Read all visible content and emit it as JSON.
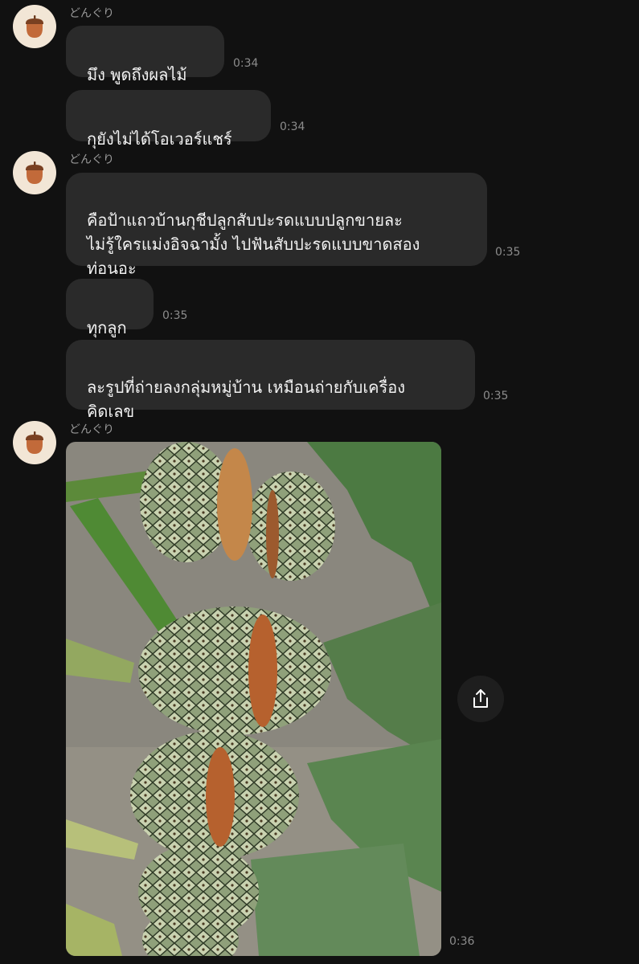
{
  "sender_name": "どんぐり",
  "messages": [
    {
      "text": "มึง พูดถึงผลไม้",
      "time": "0:34"
    },
    {
      "text": "กุยังไม่ได้โอเวอร์แชร์",
      "time": "0:34"
    },
    {
      "text": "คือป้าแถวบ้านกุชีปลูกสับปะรดแบบปลูกขายละ\nไม่รู้ใครแม่งอิจฉามั้ง ไปฟันสับปะรดแบบขาดสอง\nท่อนอะ",
      "time": "0:35"
    },
    {
      "text": "ทุกลูก",
      "time": "0:35"
    },
    {
      "text": "ละรูปที่ถ่ายลงกลุ่มหมู่บ้าน เหมือนถ่ายกับเครื่อง\nคิดเลข",
      "time": "0:35"
    }
  ],
  "photo_message": {
    "time": "0:36",
    "image": "pineapples-with-cut-marks-photo"
  },
  "icons": {
    "avatar": "acorn-icon",
    "share": "share-icon"
  },
  "colors": {
    "background": "#111111",
    "bubble": "#2a2a2a",
    "avatar_bg": "#f2e6d6",
    "acorn": "#c26a3a"
  }
}
